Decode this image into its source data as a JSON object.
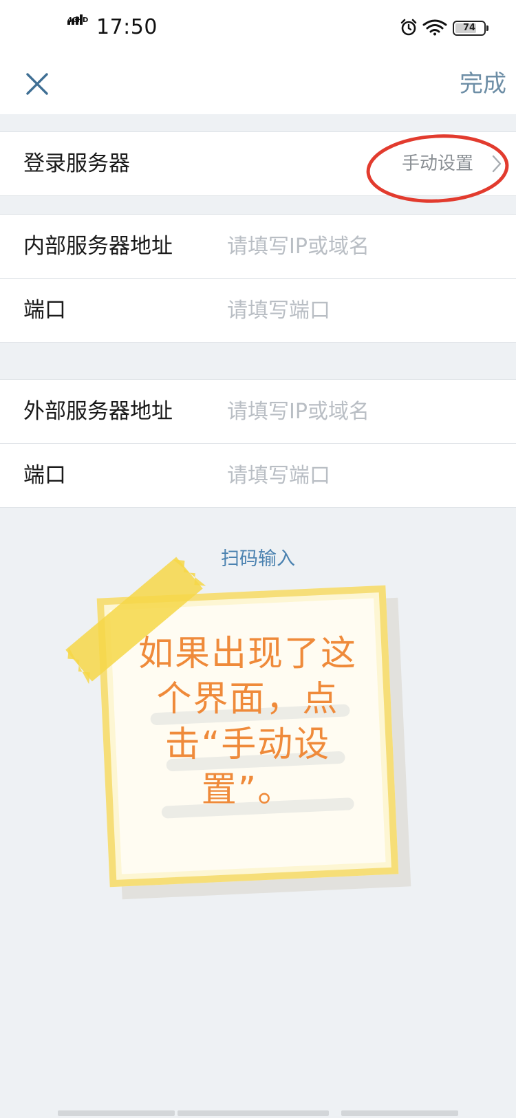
{
  "status_bar": {
    "network": "4GHD",
    "time": "17:50",
    "battery": "74",
    "battery_level": 0.74,
    "icons": [
      "signal-icon",
      "alarm-icon",
      "wifi-icon",
      "battery-icon"
    ]
  },
  "nav": {
    "close_icon": "close-icon",
    "done_label": "完成"
  },
  "login_server": {
    "label": "登录服务器",
    "value": "手动设置",
    "chevron_icon": "chevron-right-icon"
  },
  "internal": {
    "address_label": "内部服务器地址",
    "address_placeholder": "请填写IP或域名",
    "address_value": "",
    "port_label": "端口",
    "port_placeholder": "请填写端口",
    "port_value": ""
  },
  "external": {
    "address_label": "外部服务器地址",
    "address_placeholder": "请填写IP或域名",
    "address_value": "",
    "port_label": "端口",
    "port_placeholder": "请填写端口",
    "port_value": ""
  },
  "scan_input_label": "扫码输入",
  "annotation": {
    "note_lines": [
      "如果出现了这",
      "个界面，点",
      "击“手动设",
      "置”。"
    ],
    "circle_color": "#e23b2e",
    "note_text_color": "#ef8a3a",
    "tape_color": "#f6d748"
  },
  "colors": {
    "accent": "#6d8ea6",
    "link": "#4b82b0",
    "placeholder": "#b9bec4",
    "background": "#eef1f4"
  }
}
